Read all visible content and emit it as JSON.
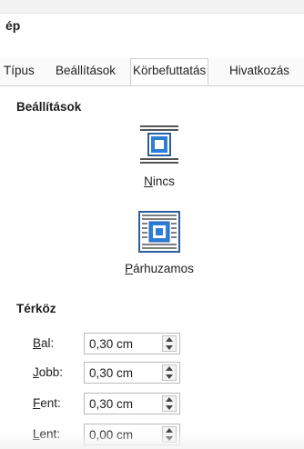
{
  "window": {
    "title_fragment": "ép"
  },
  "tabs": [
    {
      "label": "Típus",
      "active": false
    },
    {
      "label": "Beállítások",
      "active": false
    },
    {
      "label": "Körbefuttatás",
      "active": true
    },
    {
      "label": "Hivatkozás",
      "active": false
    }
  ],
  "settings": {
    "title": "Beállítások",
    "options": [
      {
        "label": "Nincs",
        "mnemonic": "N",
        "icon": "wrap-none-icon"
      },
      {
        "label": "Párhuzamos",
        "mnemonic": "P",
        "icon": "wrap-parallel-icon"
      }
    ]
  },
  "spacing": {
    "title": "Térköz",
    "rows": [
      {
        "label": "Bal:",
        "value": "0,30 cm"
      },
      {
        "label": "Jobb:",
        "value": "0,30 cm"
      },
      {
        "label": "Fent:",
        "value": "0,30 cm"
      },
      {
        "label": "Lent:",
        "value": "0,00 cm"
      }
    ]
  },
  "colors": {
    "icon_blue": "#1f5fb5",
    "icon_frame": "#2d5f9e",
    "text": "#1a1a1a"
  }
}
